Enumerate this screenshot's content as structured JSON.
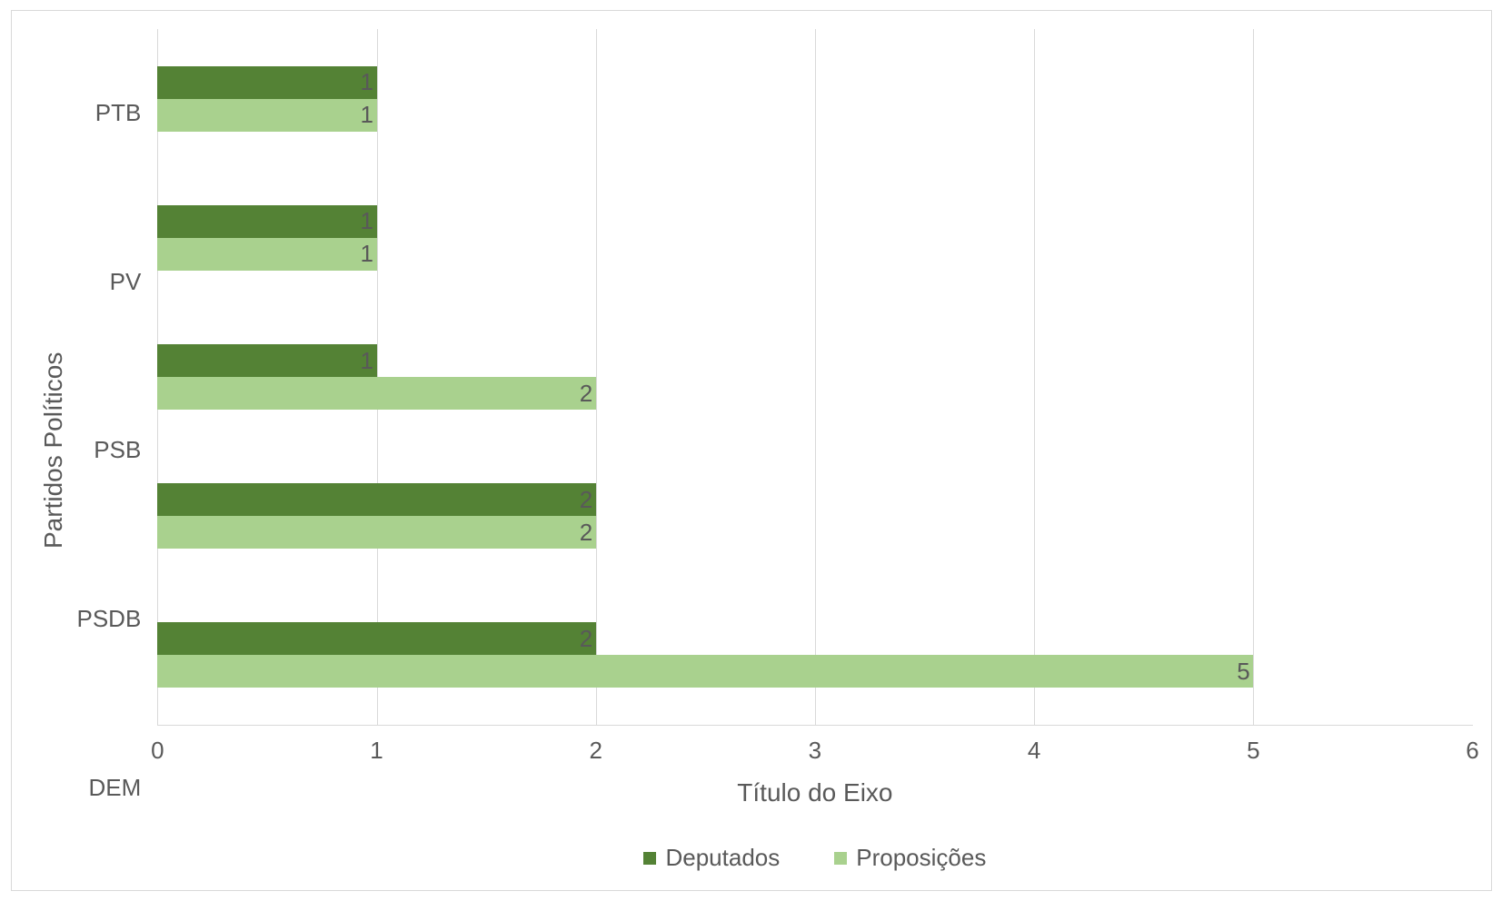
{
  "chart_data": {
    "type": "bar",
    "orientation": "horizontal",
    "categories": [
      "DEM",
      "PSDB",
      "PSB",
      "PV",
      "PTB"
    ],
    "series": [
      {
        "name": "Deputados",
        "values": [
          2,
          2,
          1,
          1,
          1
        ],
        "color": "#548235"
      },
      {
        "name": "Proposições",
        "values": [
          5,
          2,
          2,
          1,
          1
        ],
        "color": "#a9d18e"
      }
    ],
    "xlabel": "Título do Eixo",
    "ylabel": "Partidos Políticos",
    "xlim": [
      0,
      6
    ],
    "x_ticks": [
      0,
      1,
      2,
      3,
      4,
      5,
      6
    ],
    "grid": true
  },
  "legend": {
    "deputados": "Deputados",
    "proposicoes": "Proposições"
  }
}
